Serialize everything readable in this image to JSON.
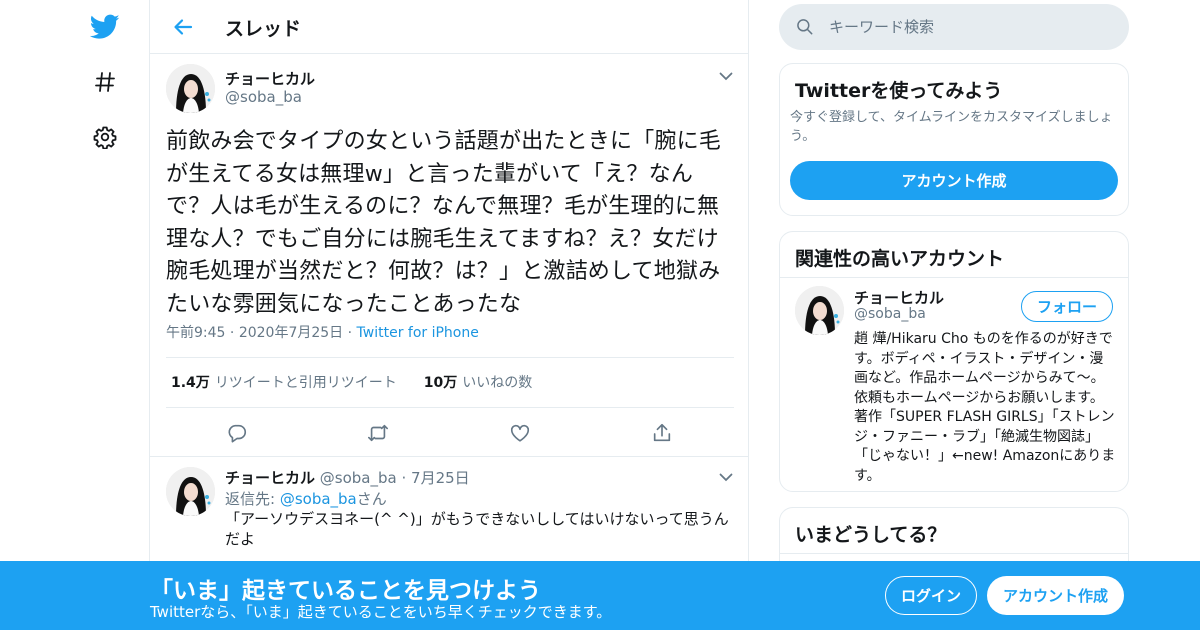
{
  "colors": {
    "accent": "#1da1f2",
    "text": "#14171a",
    "secondary": "#657786",
    "border": "#e6ecf0",
    "link": "#1b95e0"
  },
  "nav": {
    "icons": [
      "twitter-logo-icon",
      "hashtag-icon",
      "gear-icon"
    ]
  },
  "header": {
    "title": "スレッド",
    "back_icon": "arrow-left-icon"
  },
  "tweet": {
    "name": "チョーヒカル",
    "handle": "@soba_ba",
    "text": "前飲み会でタイプの女という話題が出たときに「腕に毛が生えてる女は無理w」と言った輩がいて「え？なんで？人は毛が生えるのに？なんで無理？毛が生理的に無理な人？でもご自分には腕毛生えてますね？え？女だけ腕毛処理が当然だと？何故？は？」と激詰めして地獄みたいな雰囲気になったことあったな",
    "time": "午前9:45",
    "date": "2020年7月25日",
    "source": "Twitter for iPhone",
    "retweets_count": "1.4万",
    "retweets_label": "リツイートと引用リツイート",
    "likes_count": "10万",
    "likes_label": "いいねの数"
  },
  "reply": {
    "name": "チョーヒカル",
    "handle": "@soba_ba",
    "date": "7月25日",
    "reply_prefix": "返信先: ",
    "reply_handle": "@soba_ba",
    "reply_suffix": "さん",
    "text": "「アーソウデスヨネー(^ ^)」がもうできないししてはいけないって思うんだよ"
  },
  "search": {
    "placeholder": "キーワード検索"
  },
  "signup_card": {
    "title": "Twitterを使ってみよう",
    "desc": "今すぐ登録して、タイムラインをカスタマイズしましょう。",
    "button": "アカウント作成"
  },
  "related_card": {
    "title": "関連性の高いアカウント",
    "name": "チョーヒカル",
    "handle": "@soba_ba",
    "follow": "フォロー",
    "bio": "趙 燁/Hikaru Cho ものを作るのが好きです。ボディペ・イラスト・デザイン・漫画など。作品ホームページからみて〜。依頼もホームページからお願いします。著作「SUPER FLASH GIRLS」「ストレンジ・ファニー・ラブ」「絶滅生物図誌」「じゃない！」←new! Amazonにあります。"
  },
  "trends_card": {
    "title": "いまどうしてる？"
  },
  "bottom_bar": {
    "title": "「いま」起きていることを見つけよう",
    "subtitle": "Twitterなら、「いま」起きていることをいち早くチェックできます。",
    "login": "ログイン",
    "signup": "アカウント作成"
  }
}
